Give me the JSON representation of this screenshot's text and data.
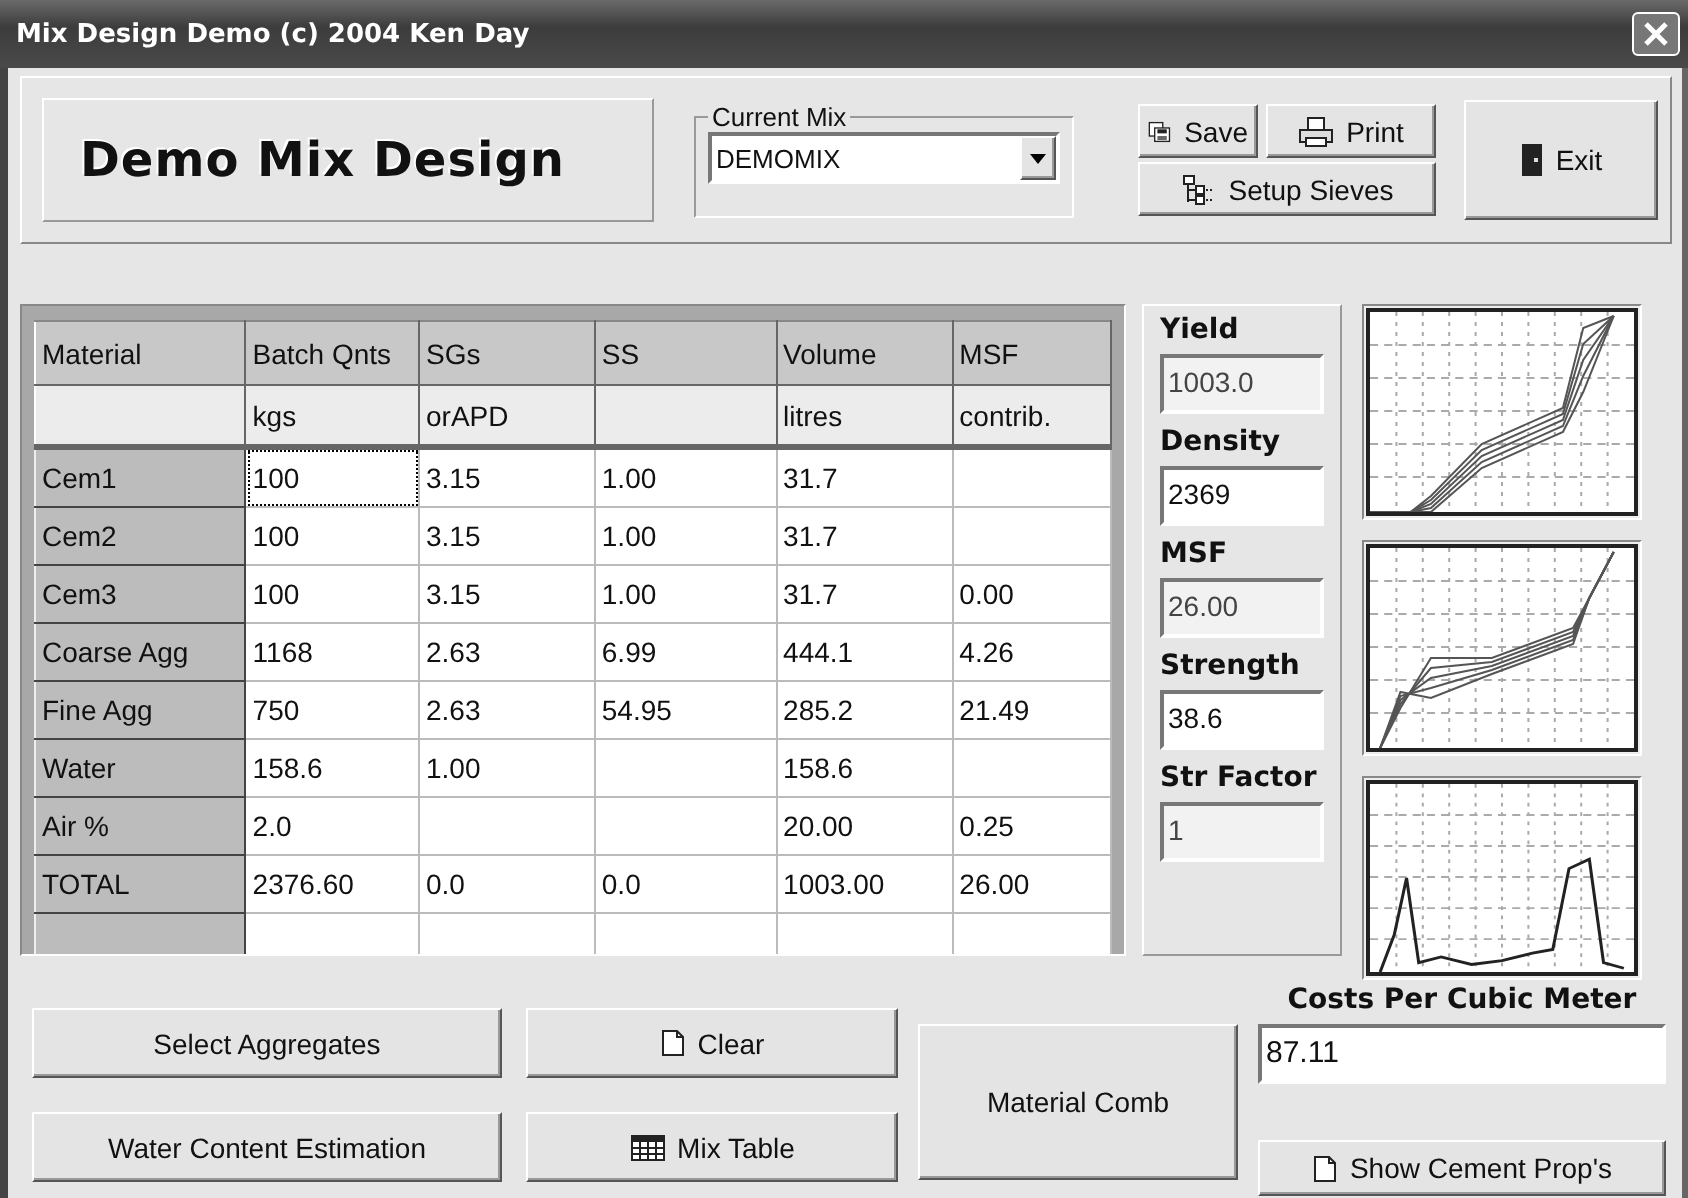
{
  "window": {
    "title": "Mix Design Demo (c) 2004 Ken Day"
  },
  "header": {
    "logo": "Demo Mix Design",
    "current_mix": {
      "label": "Current Mix",
      "value": "DEMOMIX"
    },
    "buttons": [
      {
        "kind": "save",
        "label": "Save"
      },
      {
        "kind": "print",
        "label": "Print"
      },
      {
        "kind": "sieves",
        "label": "Setup Sieves"
      },
      {
        "kind": "exit",
        "label": "Exit"
      }
    ]
  },
  "table": {
    "columns": [
      {
        "title": "Material"
      },
      {
        "title": "Batch Qnts",
        "unit": "kgs"
      },
      {
        "title": "SGs",
        "unit": "orAPD"
      },
      {
        "title": "SS"
      },
      {
        "title": "Volume",
        "unit": "litres"
      },
      {
        "title": "MSF",
        "unit": "contrib."
      }
    ],
    "rows": [
      [
        "Cem1",
        "100",
        "3.15",
        "1.00",
        "31.7",
        ""
      ],
      [
        "Cem2",
        "100",
        "3.15",
        "1.00",
        "31.7",
        ""
      ],
      [
        "Cem3",
        "100",
        "3.15",
        "1.00",
        "31.7",
        "0.00"
      ],
      [
        "Coarse Agg",
        "1168",
        "2.63",
        "6.99",
        "444.1",
        "4.26"
      ],
      [
        "Fine Agg",
        "750",
        "2.63",
        "54.95",
        "285.2",
        "21.49"
      ],
      [
        "Water",
        "158.6",
        "1.00",
        "",
        "158.6",
        ""
      ],
      [
        "Air %",
        "2.0",
        "",
        "",
        "20.00",
        "0.25"
      ],
      [
        "TOTAL",
        "2376.60",
        "0.0",
        "0.0",
        "1003.00",
        "26.00"
      ]
    ]
  },
  "results": [
    {
      "label": "Yield",
      "value": "1003.0",
      "disabled": true
    },
    {
      "label": "Density",
      "value": "2369",
      "disabled": false
    },
    {
      "label": "MSF",
      "value": "26.00",
      "disabled": true
    },
    {
      "label": "Strength",
      "value": "38.6",
      "disabled": false
    },
    {
      "label": "Str Factor",
      "value": "1",
      "disabled": true
    }
  ],
  "graphs": [
    {
      "kind": "grading"
    },
    {
      "kind": "grading_fine"
    },
    {
      "kind": "distribution"
    }
  ],
  "actions": [
    {
      "kind": "plain",
      "label": "Select Aggregates"
    },
    {
      "kind": "page",
      "label": "Clear"
    },
    {
      "kind": "tall",
      "label": "Material Comb"
    },
    {
      "kind": "plain",
      "label": "Water Content Estimation"
    },
    {
      "kind": "grid",
      "label": "Mix Table"
    }
  ],
  "costs": {
    "label": "Costs Per Cubic Meter",
    "value": "87.11",
    "button": "Show Cement Prop's"
  }
}
